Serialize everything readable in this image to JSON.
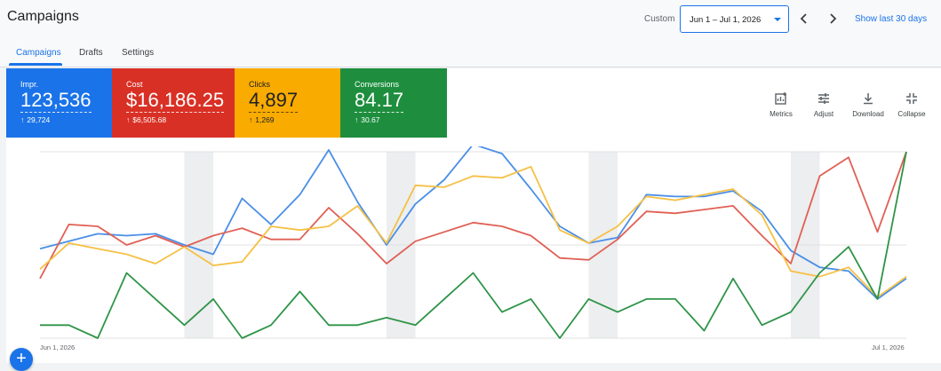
{
  "header": {
    "title": "Campaigns",
    "date_label": "Custom",
    "date_range": "Jun 1 – Jul 1, 2026",
    "show_last": "Show last 30 days"
  },
  "tabs": [
    {
      "label": "Campaigns",
      "active": true
    },
    {
      "label": "Drafts",
      "active": false
    },
    {
      "label": "Settings",
      "active": false
    }
  ],
  "metrics": [
    {
      "name": "Impr.",
      "value": "123,536",
      "delta": "29,724",
      "color": "#1a73e8"
    },
    {
      "name": "Cost",
      "value": "$16,186.25",
      "delta": "$6,505.68",
      "color": "#d93025"
    },
    {
      "name": "Clicks",
      "value": "4,897",
      "delta": "1,269",
      "color": "#f9ab00"
    },
    {
      "name": "Conversions",
      "value": "84.17",
      "delta": "30.67",
      "color": "#1e8e3e"
    }
  ],
  "toolbar": [
    {
      "label": "Metrics",
      "icon": "metrics-icon"
    },
    {
      "label": "Adjust",
      "icon": "adjust-icon"
    },
    {
      "label": "Download",
      "icon": "download-icon"
    },
    {
      "label": "Collapse",
      "icon": "collapse-icon"
    }
  ],
  "chart_data": {
    "type": "line",
    "x_start_label": "Jun 1, 2026",
    "x_end_label": "Jul 1, 2026",
    "grid": true,
    "series": [
      {
        "name": "Impr.",
        "color": "#4a8fe7",
        "values": [
          0.48,
          0.52,
          0.56,
          0.55,
          0.56,
          0.5,
          0.45,
          0.75,
          0.61,
          0.77,
          1.01,
          0.73,
          0.5,
          0.72,
          0.85,
          1.04,
          0.99,
          0.8,
          0.6,
          0.51,
          0.54,
          0.77,
          0.76,
          0.76,
          0.79,
          0.68,
          0.47,
          0.38,
          0.36,
          0.21,
          0.32
        ]
      },
      {
        "name": "Cost",
        "color": "#e06055",
        "values": [
          0.32,
          0.61,
          0.6,
          0.5,
          0.55,
          0.49,
          0.55,
          0.59,
          0.53,
          0.53,
          0.7,
          0.56,
          0.4,
          0.52,
          0.57,
          0.62,
          0.6,
          0.55,
          0.43,
          0.42,
          0.53,
          0.68,
          0.67,
          0.69,
          0.71,
          0.55,
          0.4,
          0.87,
          0.97,
          0.57,
          1.0
        ]
      },
      {
        "name": "Clicks",
        "color": "#f5c044",
        "values": [
          0.37,
          0.51,
          0.48,
          0.45,
          0.4,
          0.49,
          0.39,
          0.41,
          0.6,
          0.58,
          0.6,
          0.71,
          0.51,
          0.82,
          0.81,
          0.87,
          0.86,
          0.92,
          0.58,
          0.51,
          0.6,
          0.76,
          0.74,
          0.77,
          0.8,
          0.66,
          0.36,
          0.33,
          0.38,
          0.22,
          0.33
        ]
      },
      {
        "name": "Conversions",
        "color": "#2e9447",
        "values": [
          0.07,
          0.07,
          0.0,
          0.35,
          0.21,
          0.07,
          0.21,
          0.0,
          0.07,
          0.25,
          0.07,
          0.07,
          0.11,
          0.07,
          0.21,
          0.35,
          0.14,
          0.21,
          0.0,
          0.21,
          0.14,
          0.21,
          0.21,
          0.04,
          0.32,
          0.07,
          0.14,
          0.35,
          0.49,
          0.21,
          1.0
        ]
      }
    ],
    "shaded_bands": [
      5,
      12,
      19,
      26
    ]
  }
}
